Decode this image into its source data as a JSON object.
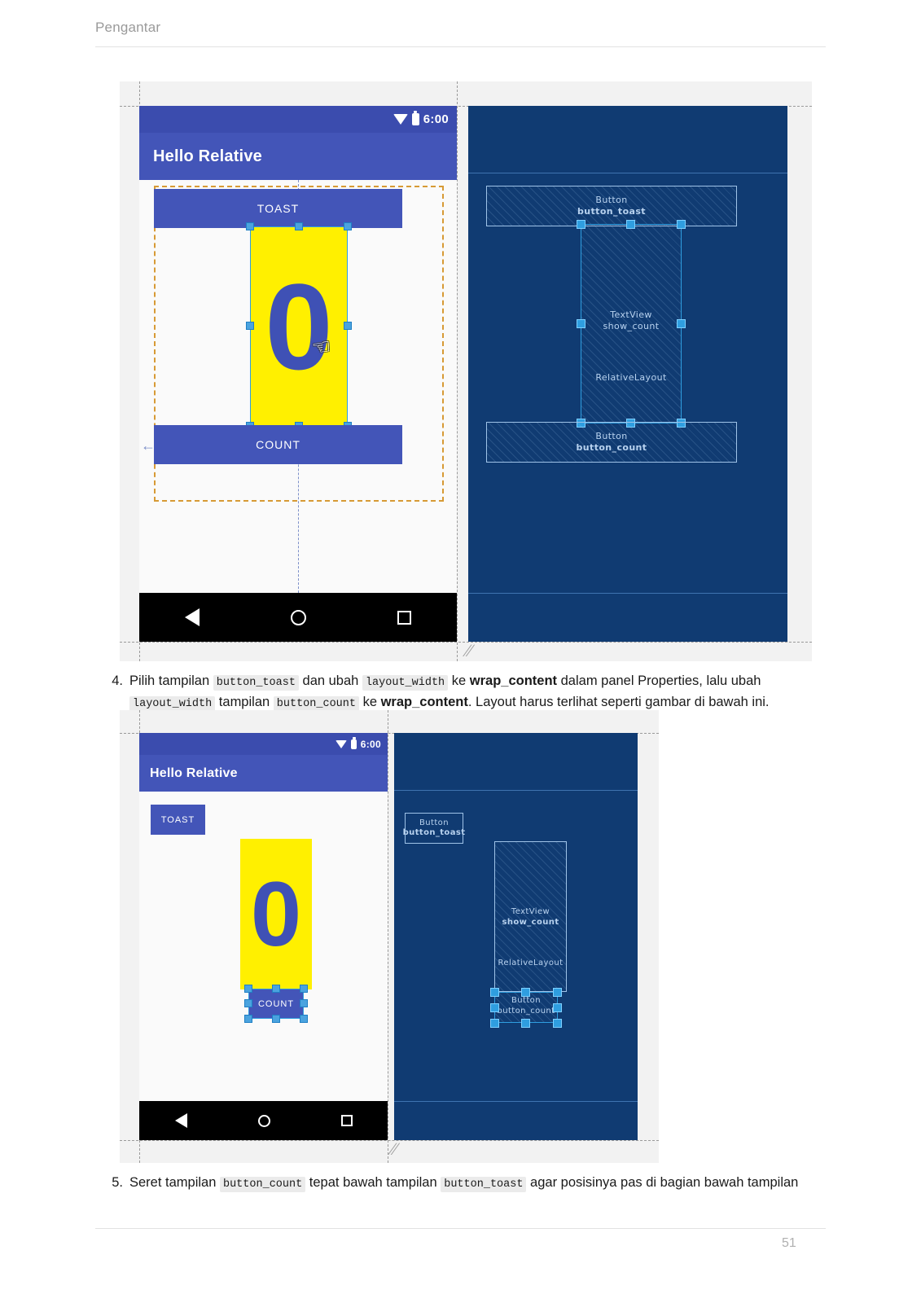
{
  "header": {
    "title": "Pengantar"
  },
  "footer": {
    "page_number": "51"
  },
  "figures": [
    {
      "id": "figure-1",
      "device": {
        "status_bar": {
          "time": "6:00",
          "wifi_icon": "wifi-icon",
          "battery_icon": "battery-icon"
        },
        "app_bar": {
          "title": "Hello Relative"
        },
        "button_toast_label": "TOAST",
        "text_count_value": "0",
        "button_count_label": "COUNT",
        "nav_bar": {
          "back": "back-icon",
          "home": "home-icon",
          "recent": "recent-apps-icon"
        },
        "cursor": "hand-pointer-cursor"
      },
      "blueprint": {
        "nodes": [
          {
            "type": "Button",
            "id": "button_toast"
          },
          {
            "type": "TextView",
            "id": "show_count"
          },
          {
            "type": "Button",
            "id": "button_count"
          }
        ],
        "container_label": "RelativeLayout"
      }
    },
    {
      "id": "figure-2",
      "device": {
        "status_bar": {
          "time": "6:00",
          "wifi_icon": "wifi-icon",
          "battery_icon": "battery-icon"
        },
        "app_bar": {
          "title": "Hello Relative"
        },
        "button_toast_label": "TOAST",
        "text_count_value": "0",
        "button_count_label": "COUNT",
        "nav_bar": {
          "back": "back-icon",
          "home": "home-icon",
          "recent": "recent-apps-icon"
        }
      },
      "blueprint": {
        "nodes": [
          {
            "type": "Button",
            "id": "button_toast"
          },
          {
            "type": "TextView",
            "id": "show_count"
          },
          {
            "type": "Button",
            "id": "button_count"
          }
        ],
        "container_label": "RelativeLayout"
      }
    }
  ],
  "steps": [
    {
      "number": "4.",
      "segments": [
        {
          "t": "text",
          "v": "Pilih tampilan "
        },
        {
          "t": "code",
          "v": "button_toast"
        },
        {
          "t": "text",
          "v": " dan ubah "
        },
        {
          "t": "code",
          "v": "layout_width"
        },
        {
          "t": "text",
          "v": " ke "
        },
        {
          "t": "bold",
          "v": "wrap_content"
        },
        {
          "t": "text",
          "v": " dalam panel Properties, lalu ubah "
        },
        {
          "t": "code",
          "v": "layout_width"
        },
        {
          "t": "text",
          "v": " tampilan "
        },
        {
          "t": "code",
          "v": "button_count"
        },
        {
          "t": "text",
          "v": " ke "
        },
        {
          "t": "bold",
          "v": "wrap_content"
        },
        {
          "t": "text",
          "v": ". Layout harus terlihat seperti gambar di bawah ini."
        }
      ]
    },
    {
      "number": "5.",
      "segments": [
        {
          "t": "text",
          "v": "Seret tampilan "
        },
        {
          "t": "code",
          "v": "button_count"
        },
        {
          "t": "text",
          "v": " tepat bawah tampilan "
        },
        {
          "t": "code",
          "v": "button_toast"
        },
        {
          "t": "text",
          "v": " agar posisinya pas di bagian bawah tampilan"
        }
      ]
    }
  ],
  "colors": {
    "app_bar_blue": "#4355b8",
    "status_bar_blue": "#3b4cae",
    "accent_yellow": "#FFF000",
    "blueprint_bg": "#103b72",
    "selection_blue": "#2f9ee0",
    "guide_orange": "#d79a35"
  }
}
